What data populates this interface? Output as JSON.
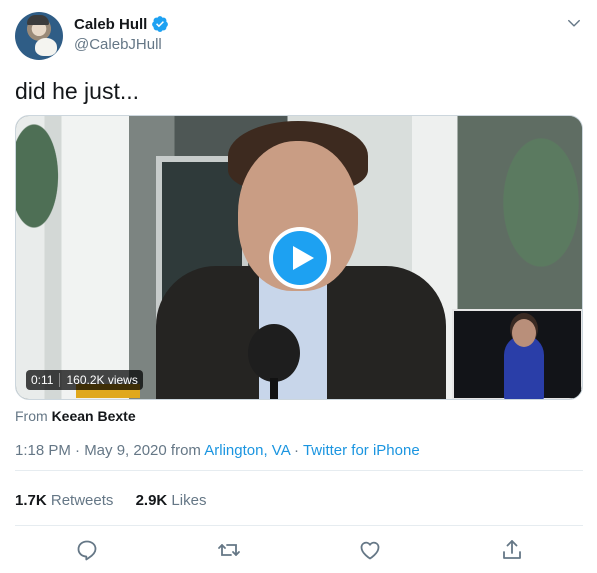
{
  "user": {
    "display_name": "Caleb Hull",
    "handle": "@CalebJHull",
    "verified": true
  },
  "tweet": {
    "text": "did he just..."
  },
  "media": {
    "duration": "0:11",
    "views": "160.2K views",
    "from_label": "From",
    "source": "Keean Bexte",
    "play_icon": "play-icon"
  },
  "meta": {
    "time_date": "1:18 PM · May 9, 2020 from ",
    "location": "Arlington, VA",
    "separator": " · ",
    "client": "Twitter for iPhone"
  },
  "stats": {
    "retweets_count": "1.7K",
    "retweets_label": "Retweets",
    "likes_count": "2.9K",
    "likes_label": "Likes"
  },
  "actions": [
    "reply-icon",
    "retweet-icon",
    "like-icon",
    "share-icon"
  ],
  "colors": {
    "accent": "#1da1f2",
    "link": "#1b95e0",
    "secondary_text": "#657786",
    "primary_text": "#14171a"
  }
}
